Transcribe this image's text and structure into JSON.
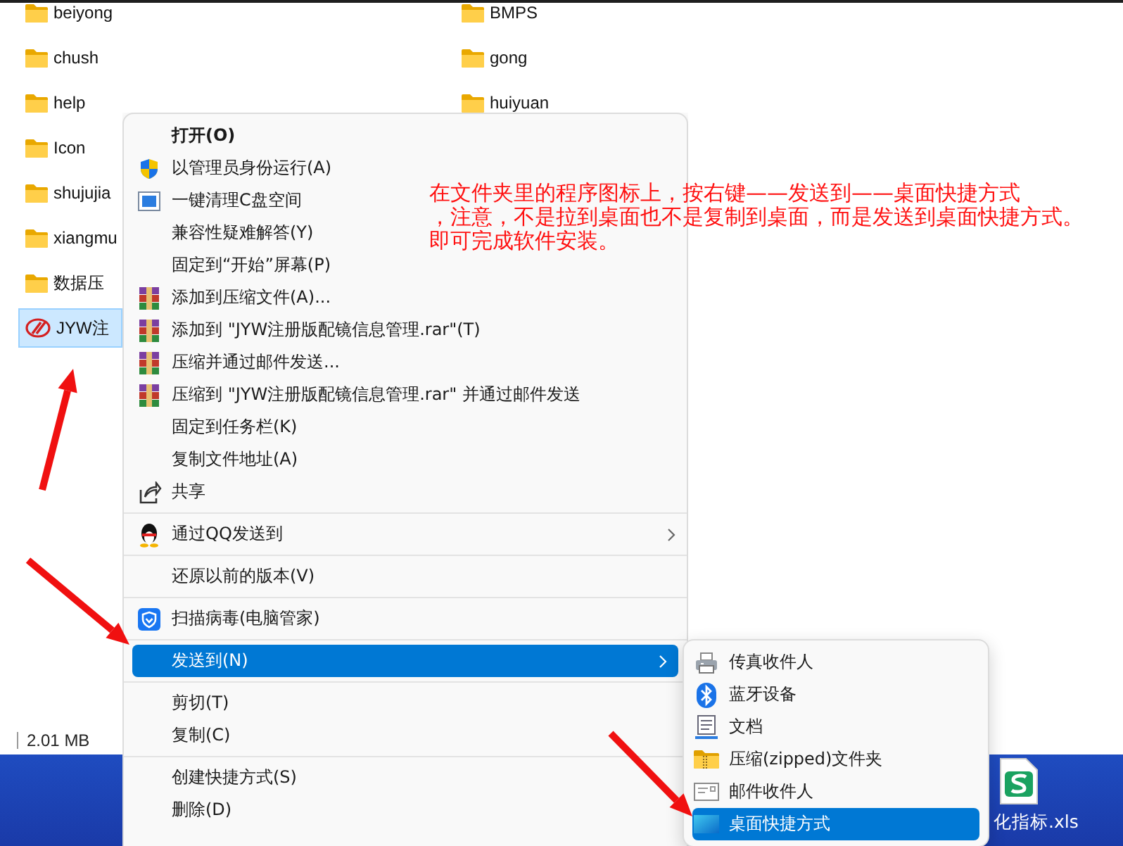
{
  "file_columns": [
    [
      {
        "name": "beiyong",
        "kind": "folder",
        "selected": false
      },
      {
        "name": "chush",
        "kind": "folder",
        "selected": false
      },
      {
        "name": "help",
        "kind": "folder",
        "selected": false
      },
      {
        "name": "Icon",
        "kind": "folder",
        "selected": false
      },
      {
        "name": "shujujia",
        "kind": "folder",
        "selected": false
      },
      {
        "name": "xiangmu",
        "kind": "folder",
        "selected": false
      },
      {
        "name": "数据压",
        "kind": "folder",
        "selected": false
      },
      {
        "name": "JYW注",
        "kind": "app",
        "selected": true
      }
    ],
    [
      {
        "name": "BMPS",
        "kind": "folder",
        "selected": false
      },
      {
        "name": "gong",
        "kind": "folder",
        "selected": false
      },
      {
        "name": "huiyuan",
        "kind": "folder",
        "selected": false
      }
    ]
  ],
  "status_bar": {
    "size": "2.01 MB"
  },
  "desktop": {
    "icons": [
      {
        "label": "化指标.xls"
      }
    ]
  },
  "context_menu": {
    "items": [
      {
        "kind": "item",
        "label": "打开(O)",
        "default": true,
        "submenu": false,
        "selected": false
      },
      {
        "kind": "item",
        "label": "以管理员身份运行(A)",
        "default": false,
        "submenu": false,
        "selected": false
      },
      {
        "kind": "item",
        "label": "一键清理C盘空间",
        "default": false,
        "submenu": false,
        "selected": false
      },
      {
        "kind": "item",
        "label": "兼容性疑难解答(Y)",
        "default": false,
        "submenu": false,
        "selected": false
      },
      {
        "kind": "item",
        "label": "固定到“开始”屏幕(P)",
        "default": false,
        "submenu": false,
        "selected": false
      },
      {
        "kind": "item",
        "label": "添加到压缩文件(A)...",
        "default": false,
        "submenu": false,
        "selected": false
      },
      {
        "kind": "item",
        "label": "添加到 \"JYW注册版配镜信息管理.rar\"(T)",
        "default": false,
        "submenu": false,
        "selected": false
      },
      {
        "kind": "item",
        "label": "压缩并通过邮件发送...",
        "default": false,
        "submenu": false,
        "selected": false
      },
      {
        "kind": "item",
        "label": "压缩到 \"JYW注册版配镜信息管理.rar\" 并通过邮件发送",
        "default": false,
        "submenu": false,
        "selected": false
      },
      {
        "kind": "item",
        "label": "固定到任务栏(K)",
        "default": false,
        "submenu": false,
        "selected": false
      },
      {
        "kind": "item",
        "label": "复制文件地址(A)",
        "default": false,
        "submenu": false,
        "selected": false
      },
      {
        "kind": "item",
        "label": "共享",
        "default": false,
        "submenu": false,
        "selected": false
      },
      {
        "kind": "separator"
      },
      {
        "kind": "item",
        "label": "通过QQ发送到",
        "default": false,
        "submenu": true,
        "selected": false
      },
      {
        "kind": "separator"
      },
      {
        "kind": "item",
        "label": "还原以前的版本(V)",
        "default": false,
        "submenu": false,
        "selected": false
      },
      {
        "kind": "separator"
      },
      {
        "kind": "item",
        "label": "扫描病毒(电脑管家)",
        "default": false,
        "submenu": false,
        "selected": false
      },
      {
        "kind": "separator"
      },
      {
        "kind": "item",
        "label": "发送到(N)",
        "default": false,
        "submenu": true,
        "selected": true
      },
      {
        "kind": "separator"
      },
      {
        "kind": "item",
        "label": "剪切(T)",
        "default": false,
        "submenu": false,
        "selected": false
      },
      {
        "kind": "item",
        "label": "复制(C)",
        "default": false,
        "submenu": false,
        "selected": false
      },
      {
        "kind": "separator"
      },
      {
        "kind": "item",
        "label": "创建快捷方式(S)",
        "default": false,
        "submenu": false,
        "selected": false
      },
      {
        "kind": "item",
        "label": "删除(D)",
        "default": false,
        "submenu": false,
        "selected": false
      }
    ]
  },
  "send_to_menu": {
    "items": [
      {
        "kind": "item",
        "label": "传真收件人",
        "selected": false
      },
      {
        "kind": "item",
        "label": "蓝牙设备",
        "selected": false
      },
      {
        "kind": "item",
        "label": "文档",
        "selected": false
      },
      {
        "kind": "item",
        "label": "压缩(zipped)文件夹",
        "selected": false
      },
      {
        "kind": "item",
        "label": "邮件收件人",
        "selected": false
      },
      {
        "kind": "item",
        "label": "桌面快捷方式",
        "selected": true
      }
    ]
  },
  "note": {
    "lines": [
      "在文件夹里的程序图标上，按右键——发送到——桌面快捷方式",
      "，注意，不是拉到桌面也不是复制到桌面，而是发送到桌面快捷方式。",
      "即可完成软件安装。"
    ]
  }
}
